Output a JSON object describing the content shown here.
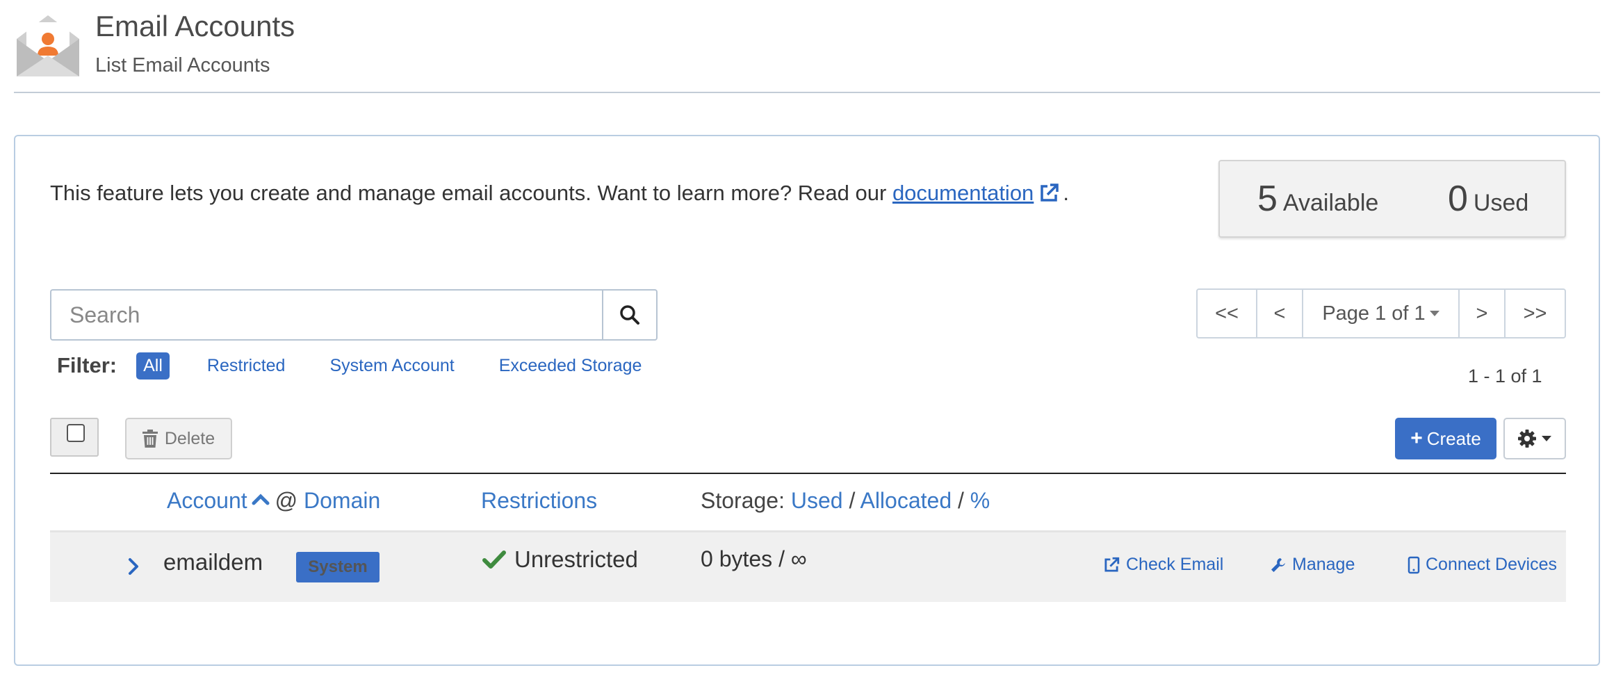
{
  "header": {
    "title": "Email Accounts",
    "subtitle": "List Email Accounts",
    "icon": "email-accounts-icon"
  },
  "intro": {
    "text": "This feature lets you create and manage email accounts. Want to learn more? Read our ",
    "link_text": "documentation",
    "suffix": "."
  },
  "quota": {
    "available_count": "5",
    "available_label": "Available",
    "used_count": "0",
    "used_label": "Used"
  },
  "search": {
    "placeholder": "Search"
  },
  "filter": {
    "label": "Filter:",
    "options": [
      "All",
      "Restricted",
      "System Account",
      "Exceeded Storage"
    ],
    "active": "All"
  },
  "pagination": {
    "first": "<<",
    "prev": "<",
    "page": "Page 1 of 1",
    "next": ">",
    "last": ">>",
    "range": "1 - 1 of 1"
  },
  "actions": {
    "delete_label": "Delete",
    "create_label": "Create"
  },
  "table": {
    "headers": {
      "account": "Account",
      "at": "@",
      "domain": "Domain",
      "restrictions": "Restrictions",
      "storage_prefix": "Storage:",
      "used": "Used",
      "allocated": "Allocated",
      "percent": "%"
    },
    "rows": [
      {
        "account": "emaildem",
        "badge": "System",
        "restriction": "Unrestricted",
        "storage": "0 bytes / ∞",
        "links": [
          "Check Email",
          "Manage",
          "Connect Devices"
        ]
      }
    ]
  },
  "colors": {
    "accent": "#3a6fc6",
    "link": "#2a66c0",
    "success": "#3f8b3f",
    "brand_orange": "#f07a33"
  }
}
